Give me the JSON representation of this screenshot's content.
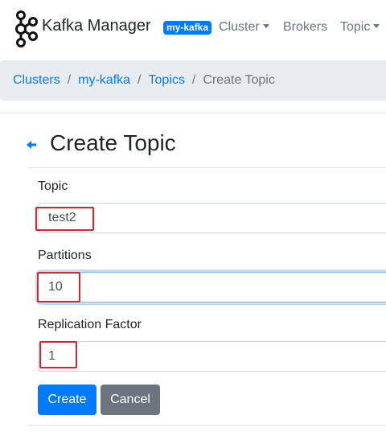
{
  "navbar": {
    "brand": "Kafka Manager",
    "cluster_badge": "my-kafka",
    "items": [
      {
        "label": "Cluster",
        "dropdown": true
      },
      {
        "label": "Brokers",
        "dropdown": false
      },
      {
        "label": "Topic",
        "dropdown": true
      }
    ]
  },
  "breadcrumb": {
    "items": [
      "Clusters",
      "my-kafka",
      "Topics"
    ],
    "separator": "/",
    "active": "Create Topic"
  },
  "form": {
    "title": "Create Topic",
    "fields": [
      {
        "label": "Topic",
        "value": "test2"
      },
      {
        "label": "Partitions",
        "value": "10"
      },
      {
        "label": "Replication Factor",
        "value": "1"
      }
    ],
    "create_label": "Create",
    "cancel_label": "Cancel"
  },
  "colors": {
    "primary": "#007bff",
    "secondary": "#6c757d",
    "highlight": "#d62728"
  }
}
